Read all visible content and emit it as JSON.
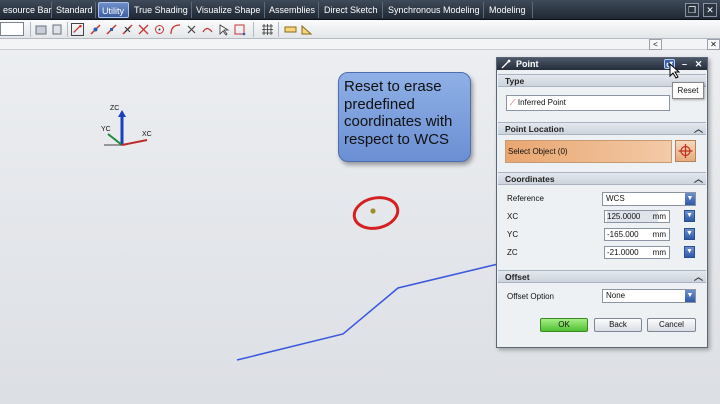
{
  "menu_tabs": [
    "esource Bar",
    "Standard",
    "Utility",
    "True Shading",
    "Visualize Shape",
    "Assemblies",
    "Direct Sketch",
    "Synchronous Modeling",
    "Modeling"
  ],
  "active_tab": "Utility",
  "axis_triad": {
    "z_label": "ZC",
    "y_label": "YC",
    "x_label": "XC"
  },
  "callout_text": "Reset to erase predefined coordinates with respect to WCS",
  "tooltip": "Reset",
  "dialog": {
    "title": "Point",
    "sections": {
      "type": "Type",
      "point_location": "Point Location",
      "coordinates": "Coordinates",
      "offset": "Offset"
    },
    "type_value": "Inferred Point",
    "select_object": "Select Object (0)",
    "reference_label": "Reference",
    "reference_value": "WCS",
    "xc_label": "XC",
    "xc_value": "125.0000",
    "yc_label": "YC",
    "yc_value": "-165.000",
    "zc_label": "ZC",
    "zc_value": "-21.0000",
    "unit": "mm",
    "offset_option_label": "Offset Option",
    "offset_option_value": "None",
    "buttons": {
      "ok": "OK",
      "back": "Back",
      "cancel": "Cancel"
    }
  },
  "colors": {
    "callout": "#7d9fdd",
    "ok_button": "#6ad24a",
    "curve": "#3a57e0",
    "highlight_circle": "#d42020"
  }
}
